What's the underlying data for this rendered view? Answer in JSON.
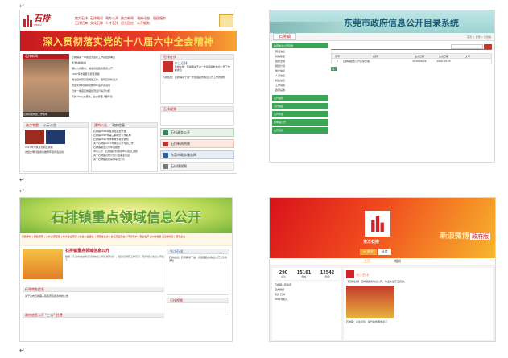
{
  "p1": {
    "logo": "石排",
    "logo_sub": "SHIPAI",
    "nav": [
      [
        "魅力石排",
        "石排概况",
        "政务公开",
        "热点新闻"
      ],
      [
        "政府动态",
        "公开服务",
        "便民服务"
      ],
      [
        "石排招商",
        "文化石排",
        "人才石排",
        "阳光回应"
      ]
    ],
    "banner": "深入贯彻落实党的十八届六中全会精神",
    "news_tab": "石排新闻",
    "news_items": [
      "石排镇第一季度经济运行工作总结部署会",
      "暂无材料新闻",
      "镇村公共服务，推进基层政务服务公开",
      "2017年市民意见调查通报",
      "推进石排镇基层党建工作，展现石排新活力",
      "省级文明村镇成功推荐年度评选活动",
      "日常一季度石排镇经济运行情况分析",
      "石排200公共服务，全力保障人居环境"
    ],
    "photo_caption": "石排基层党建工作现场",
    "left_tabs": [
      "热点专题",
      "公示公告"
    ],
    "focus_tab": "通知公告",
    "focus_tab2": "政府信息",
    "focus_items": [
      "石排镇2016年度总结表彰大会",
      "石排镇2017年第三期积分入学名单",
      "石排镇2017年学前教育收费通知",
      "关于石排镇2017年信息公开专项工作",
      "石排镇信息公开年度报告",
      "中心公示（石排镇农村贸易中心项目工程）",
      "关于石排镇农村小型公益事业建设",
      "关于石排镇政府采购项目公示"
    ],
    "weibo_head": "石排在线",
    "weibo_name": "东江石排",
    "weibo_text": "石排在线：石排镇关于进一步加强政务信息公开工作的通知",
    "side_box": "石排视频",
    "side_links": [
      "石排政务公开",
      "石排新闻热线",
      "东莞市政务服务网",
      "石排镇视频"
    ]
  },
  "p2": {
    "title": "东莞市政府信息公开目录系统",
    "tab": "石排镇",
    "toolbar": "首页 > 目录 > 石排镇",
    "side_items": [
      "政府信息公开目录",
      "概况信息",
      "机构职能",
      "政策法规",
      "规划计划",
      "统计信息",
      "人事信息",
      "财政信息",
      "工作动态",
      "政府采购"
    ],
    "table_head": [
      "序号",
      "名称",
      "发布日期",
      "生成日期",
      "文号"
    ],
    "row": [
      "1",
      "石排镇政务公开实施方案",
      "2016-09-25",
      "2016-09-25",
      ""
    ],
    "page": "1",
    "side_bottom": [
      "公开指南",
      "公开制度",
      "公开年报",
      "依申请公开",
      "公开目录"
    ]
  },
  "p3": {
    "banner": "石排镇重点领域信息公开",
    "links": "行政审批 | 财政预算 | 公共资源配置 | 重大建设项目 | 社会公益事业 | 保障性住房 | 食品药品安全 | 环境保护 | 安全生产 | 价格收费 | 征地拆迁 | 国有企业",
    "headline": "石排镇重点领域信息公开",
    "desc": "根据《东莞市推进重点领域信息公开实施方案》，结合石排镇工作实际，现将相关信息公开如下。",
    "sub_tab": "行政审批信息",
    "list": [
      "关于公布石排镇人民政府权责清单的公告"
    ],
    "list2_tab": "政府信息公开 “三公” 经费",
    "weibo_name": "东江石排",
    "weibo_text": "石排在线：石排镇关于进一步加强政务信息公开工作的通知",
    "right_head": "石排视频"
  },
  "p4": {
    "brand": "新浪微博",
    "brand2": "政府版",
    "name": "东江石排",
    "btn_follow": "+ 关注",
    "btn_msg": "私信",
    "tab_home": "主页",
    "tab_album": "相册",
    "stats": [
      [
        "290",
        "关注"
      ],
      [
        "15161",
        "粉丝"
      ],
      [
        "12542",
        "微博"
      ]
    ],
    "post_user": "东江石排",
    "post_text": "【石排在线】石排镇政务信息公开，欢迎关注东江石排。",
    "post2": "石排镇：关注民生，提升政务服务水平",
    "side_items": [
      "石排镇人民政府",
      "官方微博",
      "东莞 石排",
      "2012年加入"
    ]
  }
}
